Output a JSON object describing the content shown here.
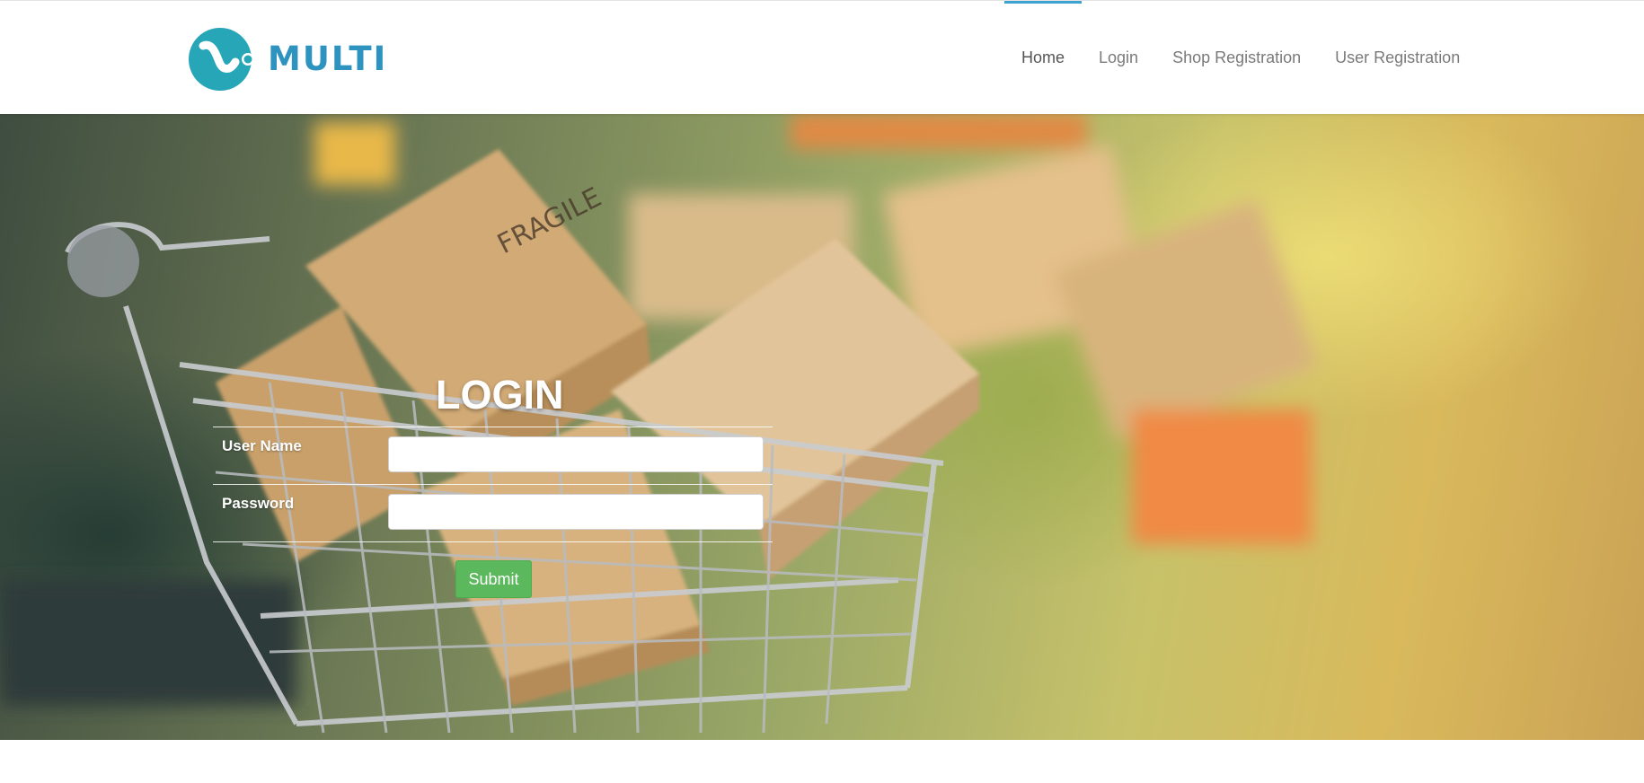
{
  "brand": {
    "name": "MULTI",
    "logo_icon": "multi-logo-icon",
    "color": "#2f93bf"
  },
  "nav": {
    "items": [
      {
        "label": "Home",
        "active": true
      },
      {
        "label": "Login",
        "active": false
      },
      {
        "label": "Shop Registration",
        "active": false
      },
      {
        "label": "User Registration",
        "active": false
      }
    ],
    "active_indicator_color": "#3ea3cf"
  },
  "hero": {
    "background": "shopping cart with cardboard boxes photo",
    "box_label": "FRAGILE"
  },
  "login": {
    "title": "LOGIN",
    "fields": [
      {
        "label": "User Name",
        "value": "",
        "placeholder": ""
      },
      {
        "label": "Password",
        "value": "",
        "placeholder": ""
      }
    ],
    "submit_label": "Submit",
    "submit_color": "#5cb85c"
  }
}
